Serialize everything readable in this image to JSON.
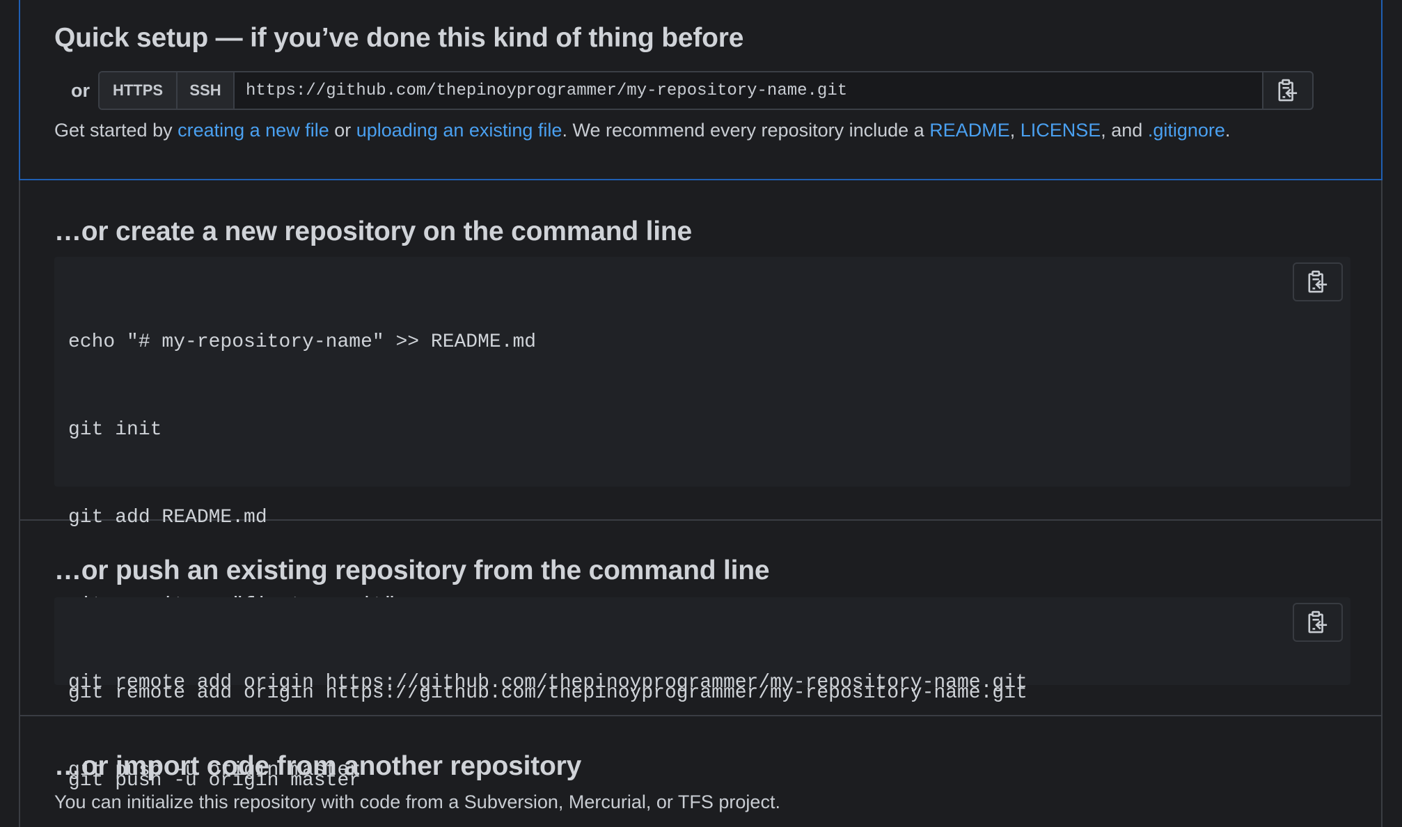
{
  "quick_setup": {
    "title": "Quick setup — if you’ve done this kind of thing before",
    "or_label": "or",
    "protocols": [
      "HTTPS",
      "SSH"
    ],
    "url": "https://github.com/thepinoyprogrammer/my-repository-name.git",
    "intro": {
      "prefix": "Get started by ",
      "link_new_file": "creating a new file",
      "or": " or ",
      "link_upload": "uploading an existing file",
      "middle": ". We recommend every repository include a ",
      "link_readme": "README",
      "comma": ", ",
      "link_license": "LICENSE",
      "and": ", and ",
      "link_gitignore": ".gitignore",
      "end": "."
    }
  },
  "create_section": {
    "title": "…or create a new repository on the command line",
    "lines": [
      "echo \"# my-repository-name\" >> README.md",
      "git init",
      "git add README.md",
      "git commit -m \"first commit\"",
      "git remote add origin https://github.com/thepinoyprogrammer/my-repository-name.git",
      "git push -u origin master"
    ]
  },
  "push_section": {
    "title": "…or push an existing repository from the command line",
    "lines": [
      "git remote add origin https://github.com/thepinoyprogrammer/my-repository-name.git",
      "git push -u origin master"
    ]
  },
  "import_section": {
    "title": "…or import code from another repository",
    "text": "You can initialize this repository with code from a Subversion, Mercurial, or TFS project."
  },
  "icons": {
    "copy": "clipboard-copy-icon"
  },
  "colors": {
    "background": "#1c1d20",
    "link": "#4aa0f0",
    "accent_border": "#1f5fb3"
  }
}
